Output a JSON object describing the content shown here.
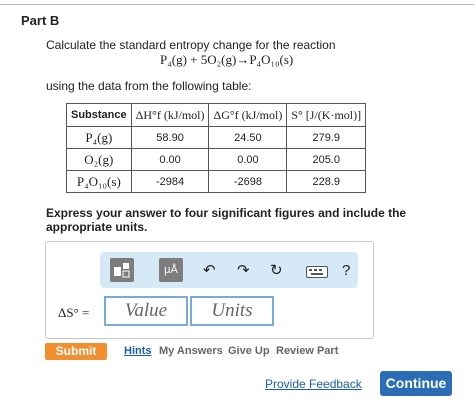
{
  "part_title": "Part B",
  "question": {
    "prompt": "Calculate the standard entropy change for the reaction",
    "reaction": "P₄(g) + 5O₂(g)→P₄O₁₀(s)",
    "table_intro": "using the data from the following table:"
  },
  "table": {
    "headers": [
      "Substance",
      "ΔH°f (kJ/mol)",
      "ΔG°f (kJ/mol)",
      "S° [J/(K·mol)]"
    ],
    "rows": [
      {
        "substance": "P₄(g)",
        "dh": "58.90",
        "dg": "24.50",
        "s": "279.9"
      },
      {
        "substance": "O₂(g)",
        "dh": "0.00",
        "dg": "0.00",
        "s": "205.0"
      },
      {
        "substance": "P₄O₁₀(s)",
        "dh": "-2984",
        "dg": "-2698",
        "s": "228.9"
      }
    ]
  },
  "instructions": "Express your answer to four significant figures and include the appropriate units.",
  "toolbar": {
    "units_label": "μÅ",
    "help_label": "?"
  },
  "answer": {
    "label": "ΔS° =",
    "value_placeholder": "Value",
    "units_placeholder": "Units"
  },
  "actions": {
    "submit": "Submit",
    "hints": "Hints",
    "my_answers": "My Answers",
    "give_up": "Give Up",
    "review_part": "Review Part",
    "provide_feedback": "Provide Feedback",
    "continue": "Continue"
  },
  "colors": {
    "submit": "#f18f2f",
    "continue": "#2b6db5",
    "link": "#1a5da8",
    "toolbar_bg": "#d6e9f7"
  }
}
